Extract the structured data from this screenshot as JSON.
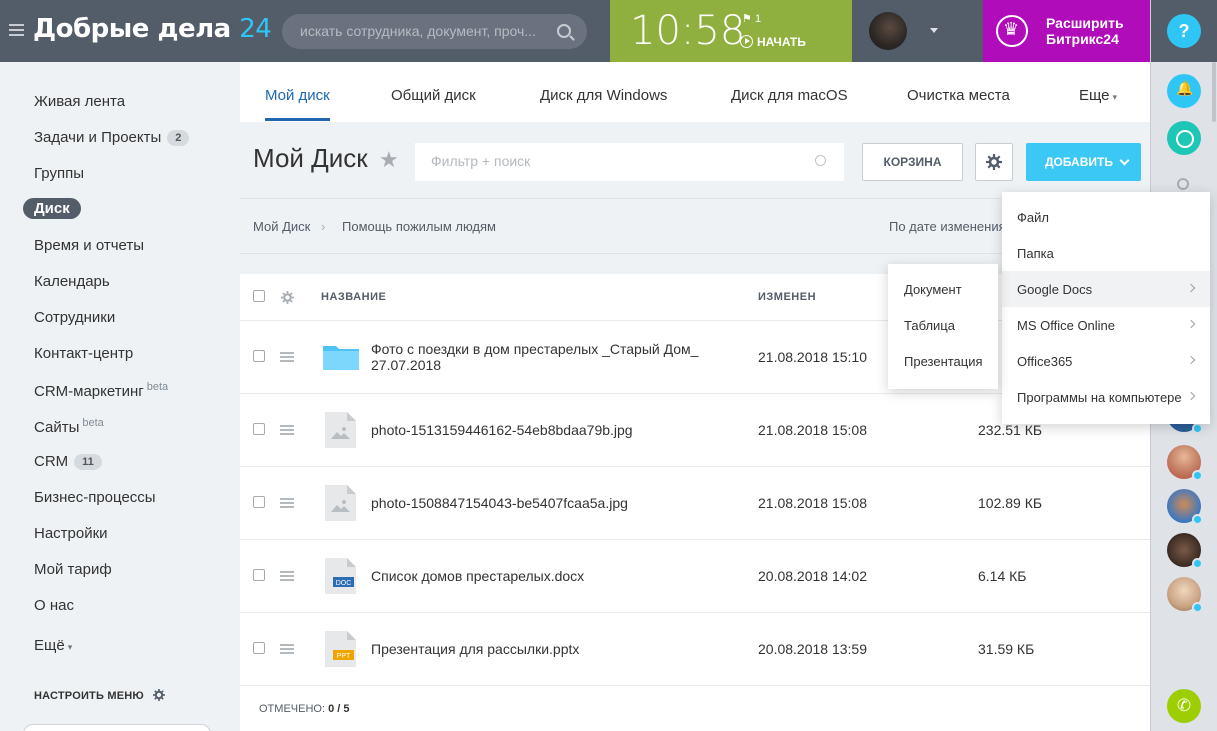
{
  "header": {
    "logo_text": "Добрые дела",
    "logo_num": "24",
    "search_placeholder": "искать сотрудника, документ, проч...",
    "time": "10:58",
    "flag_count": "1",
    "start_label": "НАЧАТЬ",
    "upgrade_label": "Расширить Битрикс24"
  },
  "right_panel": {
    "help": "?"
  },
  "left_menu": {
    "items": [
      {
        "label": "Живая лента"
      },
      {
        "label": "Задачи и Проекты",
        "counter": "2"
      },
      {
        "label": "Группы"
      },
      {
        "label": "Диск"
      },
      {
        "label": "Время и отчеты"
      },
      {
        "label": "Календарь"
      },
      {
        "label": "Сотрудники"
      },
      {
        "label": "Контакт-центр"
      },
      {
        "label": "CRM-маркетинг",
        "badge": "beta"
      },
      {
        "label": "Сайты",
        "badge": "beta"
      },
      {
        "label": "CRM",
        "counter": "11"
      },
      {
        "label": "Бизнес-процессы"
      },
      {
        "label": "Настройки"
      },
      {
        "label": "Мой тариф"
      },
      {
        "label": "О нас"
      },
      {
        "label": "Ещё"
      }
    ],
    "configure": "НАСТРОИТЬ МЕНЮ"
  },
  "tabs": [
    {
      "label": "Мой диск"
    },
    {
      "label": "Общий диск"
    },
    {
      "label": "Диск для Windows"
    },
    {
      "label": "Диск для macOS"
    },
    {
      "label": "Очистка места"
    },
    {
      "label": "Еще"
    }
  ],
  "toolbar": {
    "title": "Мой Диск",
    "filter_placeholder": "Фильтр + поиск",
    "trash_label": "КОРЗИНА",
    "add_label": "ДОБАВИТЬ"
  },
  "breadcrumb": {
    "root": "Мой Диск",
    "current": "Помощь пожилым людям",
    "sort_label": "По дате изменения"
  },
  "table": {
    "col_name": "НАЗВАНИЕ",
    "col_modified": "ИЗМЕНЕН",
    "rows": [
      {
        "name": "Фото с поездки в дом престарелых _Старый Дом_ 27.07.2018",
        "date": "21.08.2018 15:10",
        "size": "",
        "icon": "folder-icon"
      },
      {
        "name": "photo-1513159446162-54eb8bdaa79b.jpg",
        "date": "21.08.2018 15:08",
        "size": "232.51 КБ",
        "icon": "image-file-icon"
      },
      {
        "name": "photo-1508847154043-be5407fcaa5a.jpg",
        "date": "21.08.2018 15:08",
        "size": "102.89 КБ",
        "icon": "image-file-icon"
      },
      {
        "name": "Список домов престарелых.docx",
        "date": "20.08.2018 14:02",
        "size": "6.14 КБ",
        "icon": "docx-file-icon"
      },
      {
        "name": "Презентация для рассылки.pptx",
        "date": "20.08.2018 13:59",
        "size": "31.59 КБ",
        "icon": "pptx-file-icon"
      }
    ],
    "marked_label": "ОТМЕЧЕНО:",
    "marked_value": "0 / 5",
    "docx_tag": "DOC",
    "pptx_tag": "PPT"
  },
  "add_menu": {
    "items": [
      {
        "label": "Файл"
      },
      {
        "label": "Папка"
      },
      {
        "label": "Google Docs"
      },
      {
        "label": "MS Office Online"
      },
      {
        "label": "Office365"
      },
      {
        "label": "Программы на компьютере"
      }
    ],
    "sub_items": [
      {
        "label": "Документ"
      },
      {
        "label": "Таблица"
      },
      {
        "label": "Презентация"
      }
    ]
  },
  "colors": {
    "header": "#535c69",
    "accent": "#2fc6f6",
    "clock": "#8fb03e",
    "upgrade": "#b10cba",
    "tab_active": "#2067b0",
    "add_button": "#3bc8f5"
  }
}
